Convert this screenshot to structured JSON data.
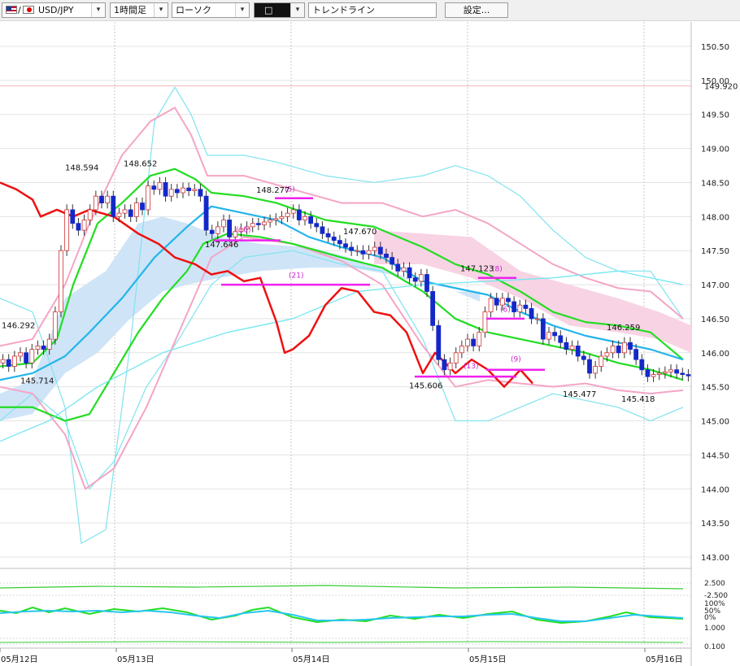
{
  "toolbar": {
    "symbol": "USD/JPY",
    "timeframe": "1時間足",
    "chart_type": "ローソク",
    "tool": "トレンドライン",
    "settings_label": "設定..."
  },
  "chart_data": {
    "type": "candlestick",
    "symbol": "USD/JPY",
    "price_axis": {
      "min": 143.0,
      "max": 150.5,
      "ticks": [
        "150.50",
        "150.00",
        "149.50",
        "149.00",
        "148.50",
        "148.00",
        "147.50",
        "147.00",
        "146.50",
        "146.00",
        "145.50",
        "145.00",
        "144.50",
        "144.00",
        "143.50",
        "143.00"
      ],
      "current_price": "149.920"
    },
    "date_labels": [
      "05月12日",
      "05月13日",
      "05月14日",
      "05月15日",
      "05月16日"
    ],
    "high_low_labels": [
      "148.594",
      "148.652",
      "148.277",
      "147.646",
      "147.670",
      "146.292",
      "145.714",
      "145.606",
      "147.123",
      "145.477",
      "146.259",
      "145.418"
    ],
    "trendline_labels": [
      "(5)",
      "(10)",
      "(21)",
      "(13)",
      "(9)",
      "(8)",
      "(6)"
    ],
    "sub_indicator": {
      "ticks": [
        "2.500",
        "-2.500",
        "100%",
        "50%",
        "0%",
        "1.000",
        "0.100"
      ]
    },
    "closes": [
      145.9,
      145.8,
      145.95,
      146.0,
      145.85,
      146.05,
      146.1,
      146.05,
      146.2,
      146.6,
      147.5,
      148.1,
      147.9,
      147.8,
      147.95,
      148.1,
      148.3,
      148.2,
      148.3,
      148.0,
      148.05,
      148.1,
      148.0,
      148.2,
      148.1,
      148.45,
      148.4,
      148.5,
      148.3,
      148.4,
      148.35,
      148.42,
      148.38,
      148.4,
      148.3,
      147.8,
      147.75,
      147.85,
      147.95,
      147.7,
      147.78,
      147.82,
      147.85,
      147.9,
      147.88,
      147.92,
      147.95,
      147.97,
      148.0,
      148.05,
      148.1,
      147.95,
      148.0,
      147.9,
      147.85,
      147.75,
      147.7,
      147.65,
      147.6,
      147.55,
      147.5,
      147.5,
      147.45,
      147.5,
      147.55,
      147.45,
      147.4,
      147.3,
      147.2,
      147.25,
      147.1,
      147.05,
      147.15,
      146.9,
      146.4,
      145.9,
      145.75,
      145.85,
      146.0,
      146.1,
      146.2,
      146.1,
      146.3,
      146.6,
      146.8,
      146.7,
      146.8,
      146.75,
      146.6,
      146.7,
      146.65,
      146.5,
      146.5,
      146.2,
      146.3,
      146.25,
      146.15,
      146.05,
      146.1,
      145.95,
      145.9,
      145.7,
      145.8,
      145.95,
      146.0,
      146.1,
      146.0,
      146.15,
      146.05,
      145.9,
      145.75,
      145.65,
      145.68,
      145.7,
      145.72,
      145.75,
      145.7,
      145.68,
      145.66
    ]
  }
}
